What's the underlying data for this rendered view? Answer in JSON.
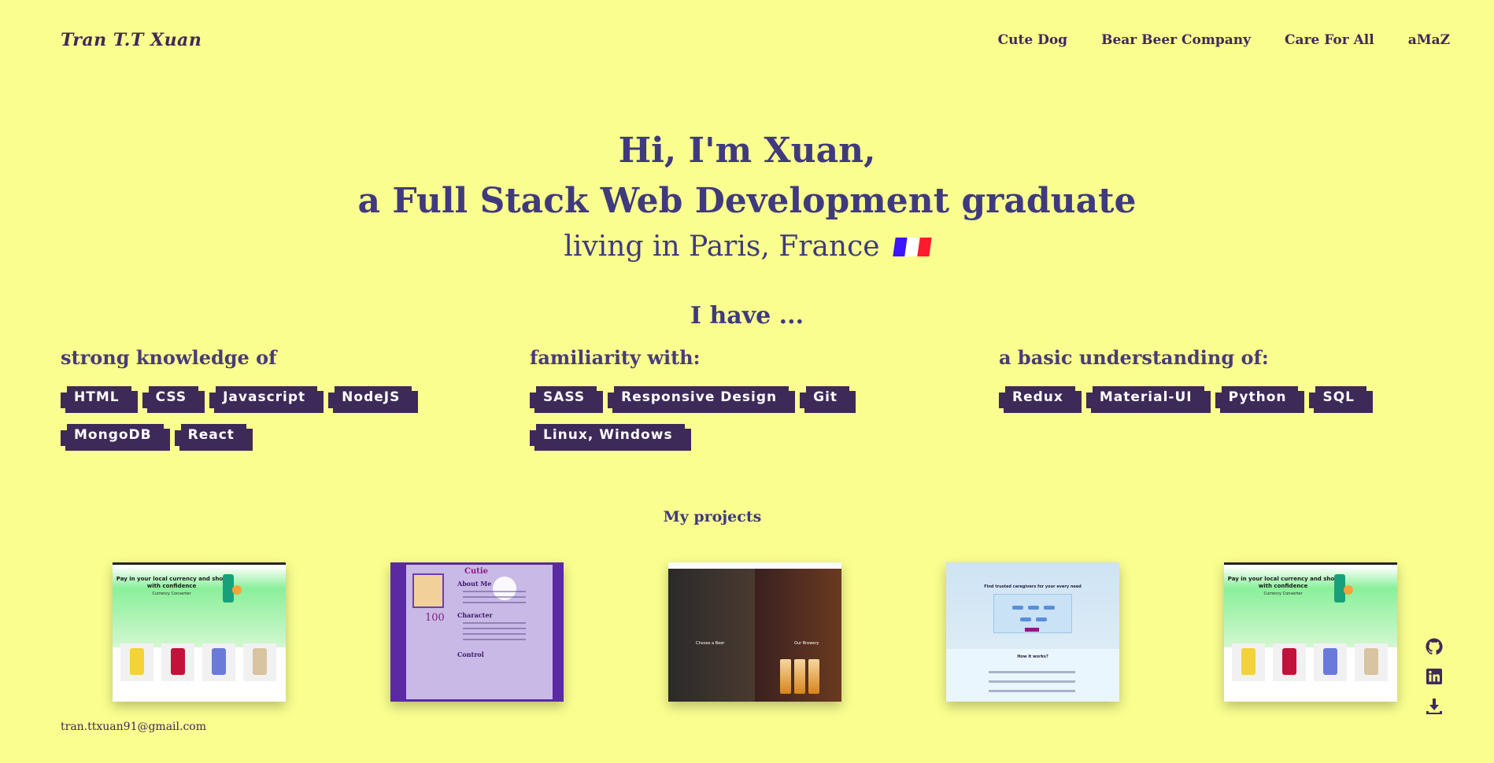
{
  "header": {
    "brand": "Tran T.T Xuan",
    "nav": [
      "Cute Dog",
      "Bear Beer Company",
      "Care For All",
      "aMaZ"
    ]
  },
  "hero": {
    "line1": "Hi, I'm Xuan,",
    "line2": "a Full Stack Web Development graduate",
    "line3": "living in Paris, France"
  },
  "skills": {
    "heading": "I have ...",
    "strong": {
      "title": "strong knowledge of",
      "tags": [
        "HTML",
        "CSS",
        "Javascript",
        "NodeJS",
        "MongoDB",
        "React"
      ]
    },
    "familiar": {
      "title": "familiarity with:",
      "tags": [
        "SASS",
        "Responsive Design",
        "Git",
        "Linux, Windows"
      ]
    },
    "basic": {
      "title": "a basic understanding of:",
      "tags": [
        "Redux",
        "Material-UI",
        "Python",
        "SQL"
      ]
    }
  },
  "projects": {
    "title": "My projects",
    "thumbs": [
      {
        "caption": "Pay in your local currency and shop with confidence",
        "sub": "Currency Converter"
      },
      {
        "name": "Cutie",
        "about": "About Me",
        "character": "Character",
        "control": "Control",
        "score": "100"
      },
      {
        "left": "Choose a Beer",
        "right": "Our Brewery"
      },
      {
        "title": "Find trusted caregivers for your every need",
        "how": "How it works?"
      },
      {
        "caption": "Pay in your local currency and shop with confidence",
        "sub": "Currency Converter"
      }
    ]
  },
  "footer": {
    "email": "tran.ttxuan91@gmail.com",
    "icons": [
      "github-icon",
      "linkedin-icon",
      "download-icon"
    ]
  },
  "colors": {
    "background": "#f9fe8f",
    "text": "#3f3a7d",
    "tag_bg": "#3d2a59",
    "flag": [
      "#3d14ff",
      "#ffffff",
      "#ff1a2e"
    ]
  }
}
